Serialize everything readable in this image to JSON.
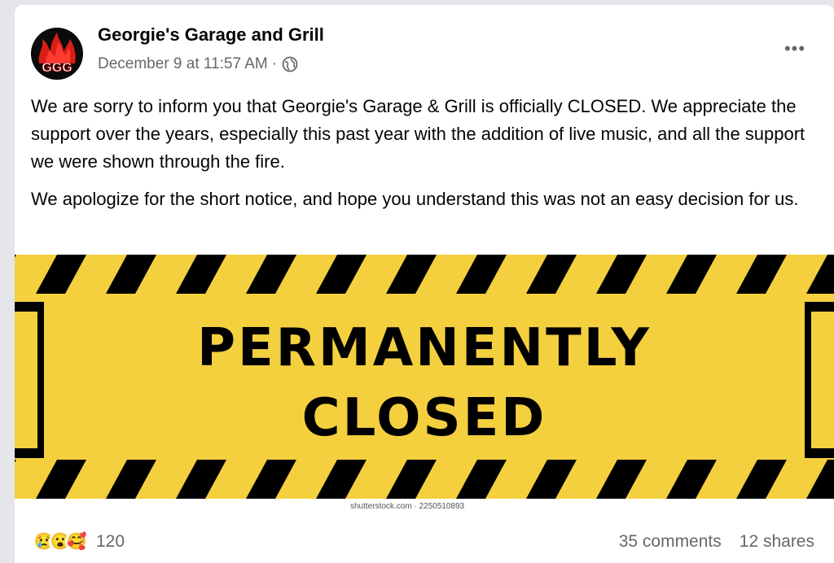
{
  "post": {
    "page_name": "Georgie's Garage and Grill",
    "avatar_text": "GGG",
    "timestamp": "December 9 at 11:57 AM",
    "separator": "·",
    "audience_icon": "globe-icon",
    "more_icon": "more-options-icon",
    "more_label": "•••",
    "paragraphs": [
      "We are sorry to inform you that Georgie's Garage & Grill is officially CLOSED.  We appreciate the support over the years, especially this past year with the addition of live music, and all the support we were shown through the fire.",
      "We apologize for the short notice, and hope you understand this was not an easy decision for us."
    ]
  },
  "image": {
    "line1": "PERMANENTLY",
    "line2": "CLOSED",
    "watermark": "shutterstock.com · 2250510893",
    "colors": {
      "yellow": "#f4d03f",
      "black": "#000000"
    }
  },
  "engagement": {
    "reactions": [
      "😢",
      "😮",
      "🥰"
    ],
    "reaction_icons": [
      "sad-reaction-icon",
      "wow-reaction-icon",
      "care-reaction-icon"
    ],
    "reaction_count": "120",
    "comments": "35 comments",
    "shares": "12 shares"
  }
}
